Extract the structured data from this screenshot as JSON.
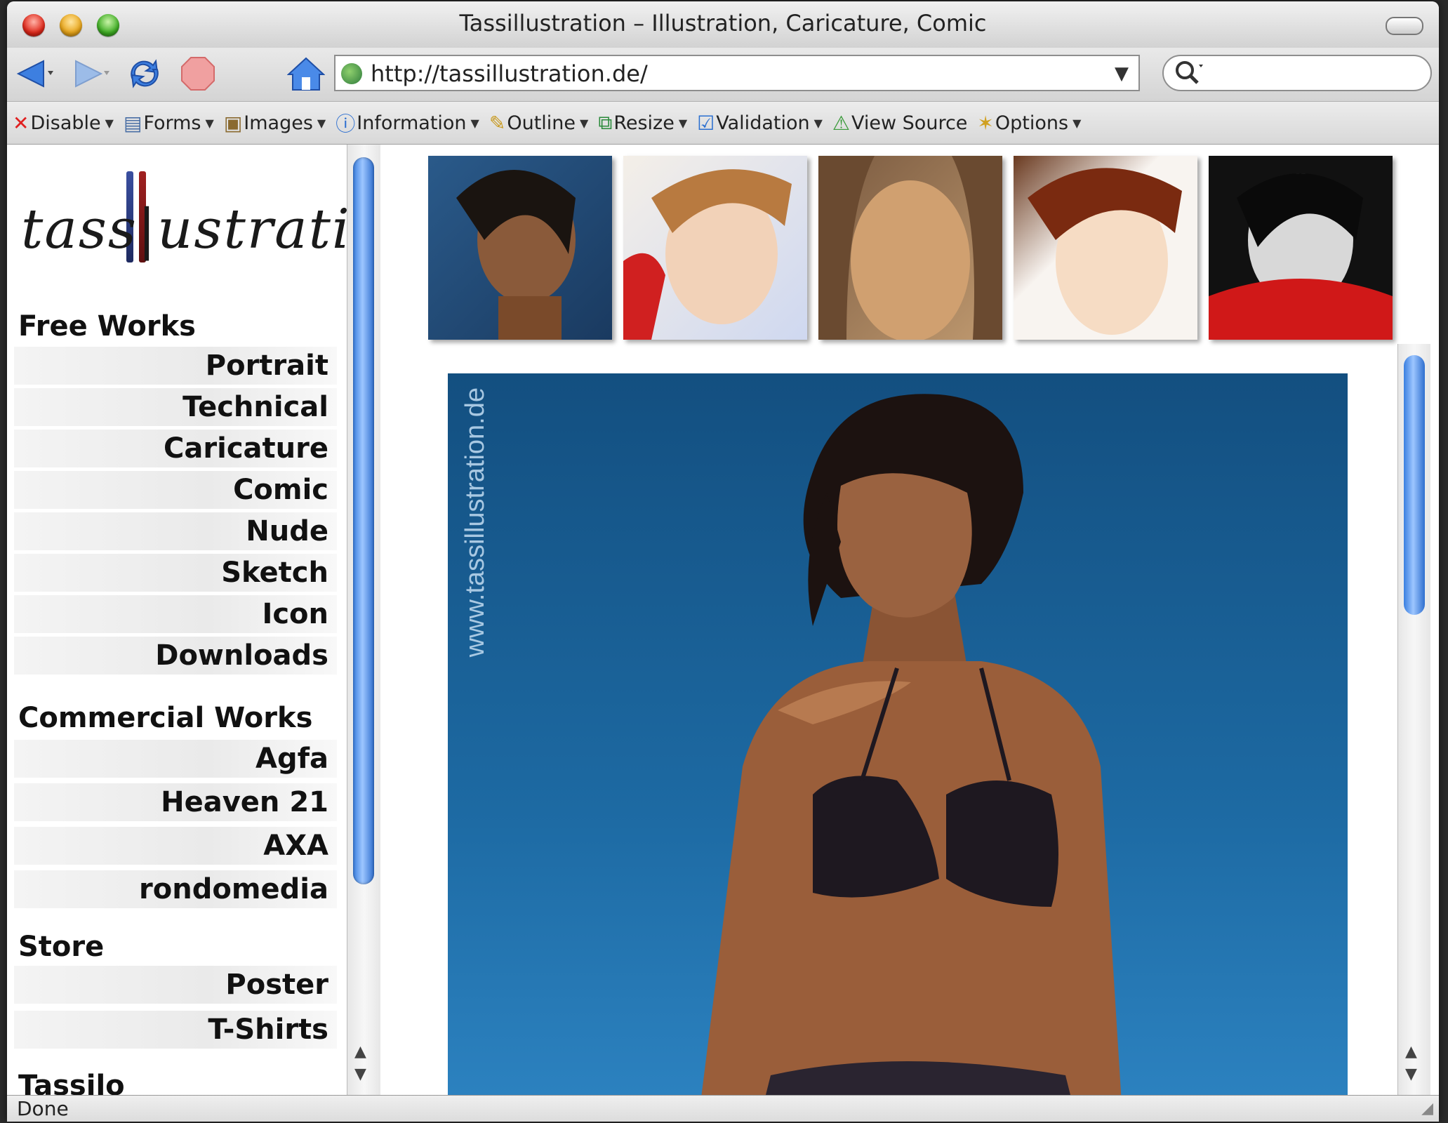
{
  "window": {
    "title": "Tassillustration – Illustration, Caricature, Comic"
  },
  "navigation": {
    "url": "http://tassillustration.de/",
    "back_icon": "back-arrow-icon",
    "forward_icon": "forward-arrow-icon",
    "reload_icon": "reload-icon",
    "stop_icon": "stop-icon",
    "home_icon": "home-icon"
  },
  "devtoolbar": {
    "items": [
      {
        "label": "Disable",
        "icon": "disable-x-icon"
      },
      {
        "label": "Forms",
        "icon": "forms-icon"
      },
      {
        "label": "Images",
        "icon": "images-icon"
      },
      {
        "label": "Information",
        "icon": "info-icon"
      },
      {
        "label": "Outline",
        "icon": "pencil-icon"
      },
      {
        "label": "Resize",
        "icon": "resize-icon"
      },
      {
        "label": "Validation",
        "icon": "validation-check-icon"
      },
      {
        "label": "View Source",
        "icon": "view-source-icon"
      },
      {
        "label": "Options",
        "icon": "wand-icon"
      }
    ]
  },
  "sidebar": {
    "logo_text": "tass|ustration",
    "free_works": {
      "heading": "Free Works",
      "items": [
        "Portrait",
        "Technical",
        "Caricature",
        "Comic",
        "Nude",
        "Sketch",
        "Icon",
        "Downloads"
      ]
    },
    "commercial_works": {
      "heading": "Commercial Works",
      "items": [
        "Agfa",
        "Heaven 21",
        "AXA",
        "rondomedia"
      ]
    },
    "store": {
      "heading": "Store",
      "items": [
        "Poster",
        "T-Shirts"
      ]
    },
    "tassilo": {
      "heading": "Tassilo"
    }
  },
  "main": {
    "watermark": "www.tassillustration.de"
  },
  "status": {
    "text": "Done"
  },
  "colors": {
    "hero_blue": "#1d6aa3",
    "scroll_blue": "#3a7fe0"
  }
}
